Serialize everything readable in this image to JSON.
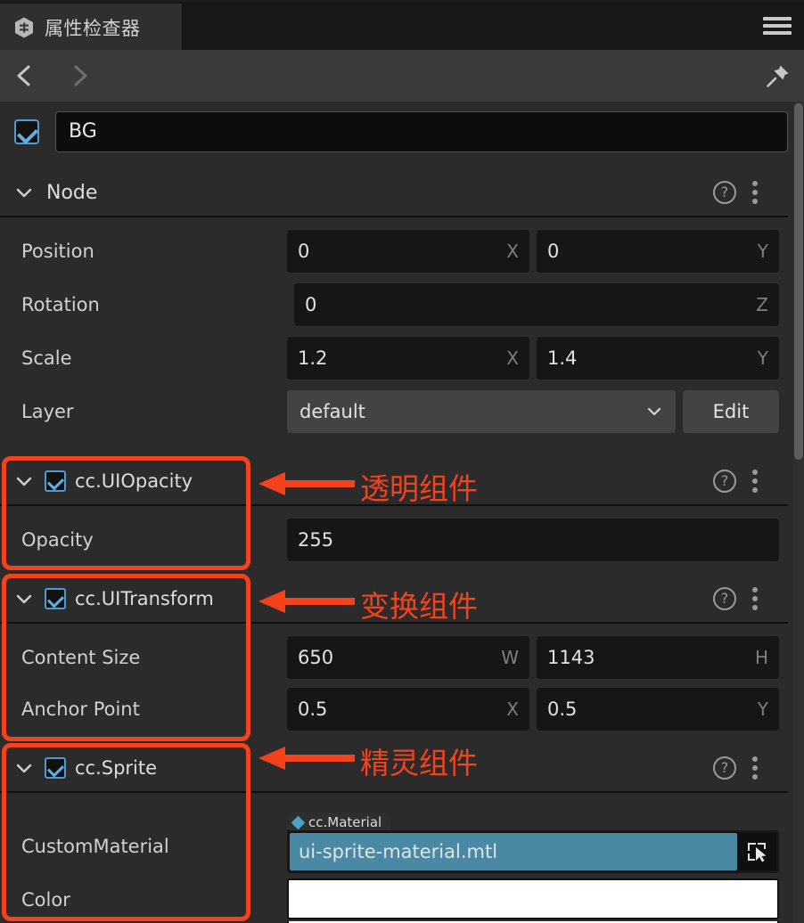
{
  "window": {
    "tab_label": "属性检查器",
    "tab_icon": "hexagon-node-icon",
    "menu_icon": "hamburger-menu-icon"
  },
  "navbar": {
    "back_icon": "chevron-left-icon",
    "forward_icon": "chevron-right-icon",
    "pin_icon": "pin-icon"
  },
  "node": {
    "enabled": true,
    "name": "BG",
    "section_title": "Node",
    "help_icon": "question-mark-icon",
    "more_icon": "kebab-menu-icon",
    "properties": [
      {
        "label": "Position",
        "fields": [
          {
            "value": "0",
            "axis": "X"
          },
          {
            "value": "0",
            "axis": "Y"
          }
        ]
      },
      {
        "label": "Rotation",
        "fields": [
          {
            "value": "0",
            "axis": "Z"
          }
        ]
      },
      {
        "label": "Scale",
        "fields": [
          {
            "value": "1.2",
            "axis": "X"
          },
          {
            "value": "1.4",
            "axis": "Y"
          }
        ]
      }
    ],
    "layer": {
      "label": "Layer",
      "selected": "default",
      "edit_label": "Edit",
      "chevron_icon": "chevron-down-icon"
    }
  },
  "components": [
    {
      "title": "cc.UIOpacity",
      "enabled": true,
      "rows": [
        {
          "label": "Opacity",
          "value": "255"
        }
      ]
    },
    {
      "title": "cc.UITransform",
      "enabled": true,
      "rows": [
        {
          "label": "Content Size",
          "fields": [
            {
              "value": "650",
              "axis": "W"
            },
            {
              "value": "1143",
              "axis": "H"
            }
          ]
        },
        {
          "label": "Anchor Point",
          "fields": [
            {
              "value": "0.5",
              "axis": "X"
            },
            {
              "value": "0.5",
              "axis": "Y"
            }
          ]
        }
      ]
    },
    {
      "title": "cc.Sprite",
      "enabled": true,
      "rows": [
        {
          "label": "CustomMaterial",
          "asset_type": "cc.Material",
          "asset_value": "ui-sprite-material.mtl",
          "pick_icon": "select-node-icon"
        },
        {
          "label": "Color",
          "color": "#ffffff"
        }
      ]
    }
  ],
  "annotations": {
    "color": "#f4421d",
    "items": [
      {
        "text": "透明组件",
        "target": "cc.UIOpacity"
      },
      {
        "text": "变换组件",
        "target": "cc.UITransform"
      },
      {
        "text": "精灵组件",
        "target": "cc.Sprite"
      }
    ]
  }
}
